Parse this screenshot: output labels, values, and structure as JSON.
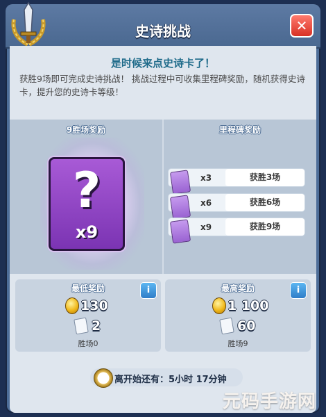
{
  "title": "史诗挑战",
  "headline": "是时候来点史诗卡了！",
  "description": "获胜9场即可完成史诗挑战！ 挑战过程中可收集里程碑奖励，随机获得史诗卡，提升您的史诗卡等级！",
  "main_reward": {
    "title": "9胜场奖励",
    "card_symbol": "?",
    "card_count": "x9"
  },
  "milestones": {
    "title": "里程碑奖励",
    "items": [
      {
        "count": "x3",
        "label": "获胜3场"
      },
      {
        "count": "x6",
        "label": "获胜6场"
      },
      {
        "count": "x9",
        "label": "获胜9场"
      }
    ]
  },
  "min_reward": {
    "title": "最低奖励",
    "gold": "130",
    "cards": "2",
    "wins": "胜场0"
  },
  "max_reward": {
    "title": "最高奖励",
    "gold": "1 100",
    "cards": "60",
    "wins": "胜场9"
  },
  "timer": {
    "text": "离开始还有：5小时 17分钟"
  },
  "watermark": "元码手游网",
  "icons": {
    "close": "close-icon",
    "info": "info-icon",
    "coin": "gold-coin-icon",
    "card": "card-icon",
    "clock": "clock-icon",
    "emblem": "sword-laurel-emblem-icon"
  },
  "colors": {
    "close": "#d83125",
    "info": "#2f7dc8",
    "epic": "#7b34b3",
    "headline": "#1f6b8a"
  }
}
